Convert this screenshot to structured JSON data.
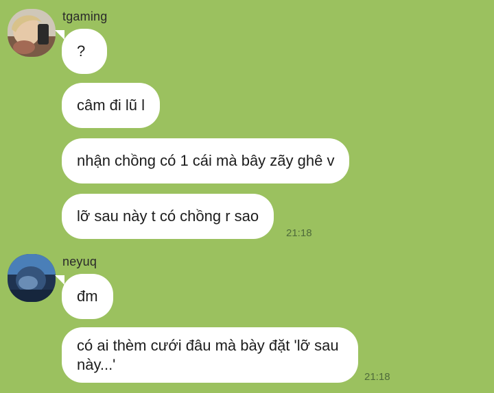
{
  "conversation": {
    "groups": [
      {
        "sender": "tgaming",
        "messages": [
          {
            "text": "?"
          },
          {
            "text": "câm đi lũ l"
          },
          {
            "text": "nhận chồng có 1 cái mà bây zãy ghê v"
          },
          {
            "text": "lỡ sau này t có chồng r sao",
            "time": "21:18"
          }
        ]
      },
      {
        "sender": "neyuq",
        "messages": [
          {
            "text": "đm"
          },
          {
            "text": "có ai thèm cưới đâu mà bày đặt 'lỡ sau này...'",
            "time": "21:18"
          }
        ]
      }
    ]
  },
  "colors": {
    "background": "#9bc15f",
    "bubble": "#ffffff",
    "timestamp": "#4e6a3a"
  },
  "icons": {
    "avatar_1": "profile-photo",
    "avatar_2": "profile-photo"
  }
}
